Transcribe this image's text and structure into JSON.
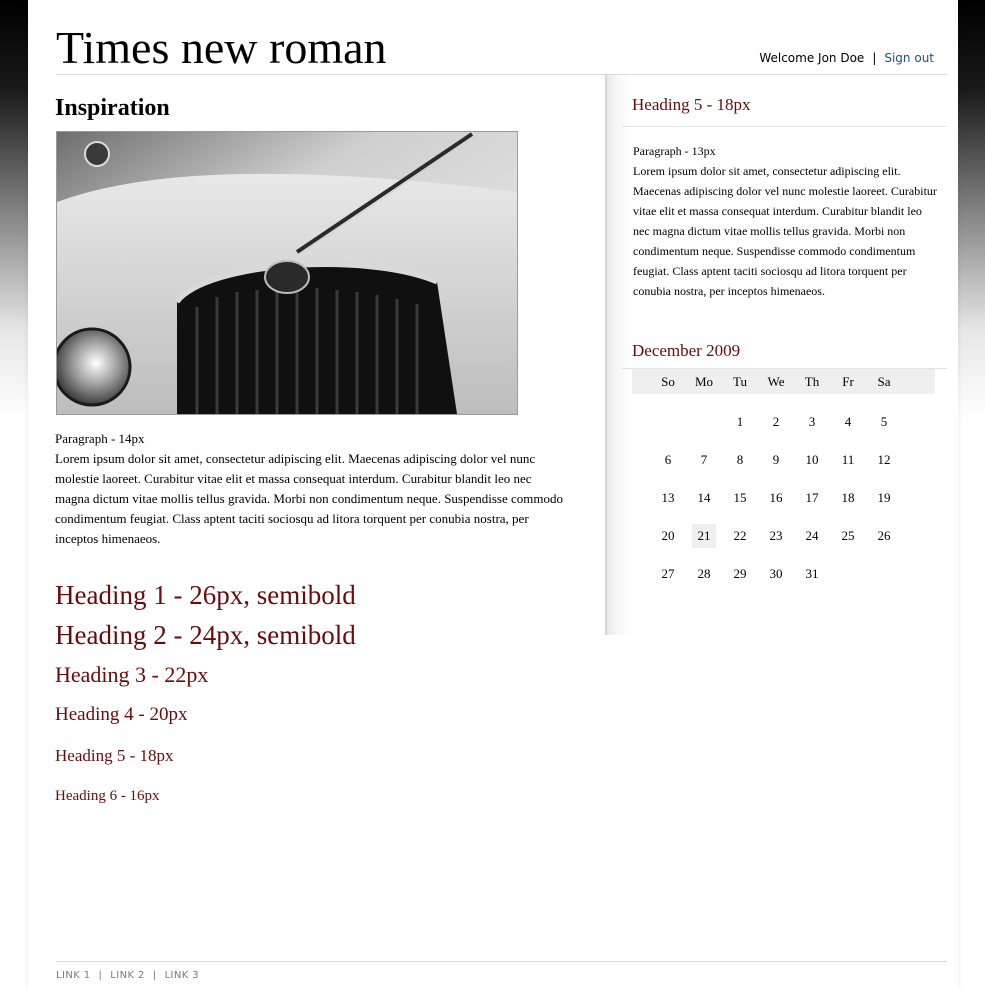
{
  "header": {
    "title": "Times new roman",
    "welcome": "Welcome Jon Doe",
    "separator": "|",
    "sign_out": "Sign out"
  },
  "main": {
    "section_title": "Inspiration",
    "image_icon": "car-photo",
    "paragraph_label": "Paragraph - 14px",
    "paragraph_text": "Lorem ipsum dolor sit amet, consectetur adipiscing elit. Maecenas adipiscing dolor vel nunc molestie laoreet. Curabitur vitae elit et massa consequat interdum. Curabitur blandit leo nec magna dictum vitae mollis tellus gravida. Morbi non condimentum neque. Suspendisse commodo condimentum feugiat. Class aptent taciti sociosqu ad litora torquent per conubia nostra, per inceptos himenaeos.",
    "headings": {
      "h1": "Heading 1 - 26px, semibold",
      "h2": "Heading 2 - 24px, semibold",
      "h3": "Heading 3 - 22px",
      "h4": "Heading 4 - 20px",
      "h5": "Heading 5 - 18px",
      "h6": "Heading 6 - 16px"
    }
  },
  "sidebar": {
    "heading": "Heading 5 - 18px",
    "paragraph_label": "Paragraph - 13px",
    "paragraph_text": "Lorem ipsum dolor sit amet, consectetur adipiscing elit. Maecenas adipiscing dolor vel nunc molestie laoreet. Curabitur vitae elit et massa consequat interdum. Curabitur blandit leo nec magna dictum vitae mollis tellus gravida. Morbi non condimentum neque. Suspendisse commodo condimentum feugiat. Class aptent taciti sociosqu ad litora torquent per conubia nostra, per inceptos himenaeos.",
    "calendar": {
      "title": "December 2009",
      "weekdays": [
        "So",
        "Mo",
        "Tu",
        "We",
        "Th",
        "Fr",
        "Sa"
      ],
      "weeks": [
        [
          "",
          "",
          "1",
          "2",
          "3",
          "4",
          "5"
        ],
        [
          "6",
          "7",
          "8",
          "9",
          "10",
          "11",
          "12"
        ],
        [
          "13",
          "14",
          "15",
          "16",
          "17",
          "18",
          "19"
        ],
        [
          "20",
          "21",
          "22",
          "23",
          "24",
          "25",
          "26"
        ],
        [
          "27",
          "28",
          "29",
          "30",
          "31",
          "",
          ""
        ]
      ],
      "today": "21"
    }
  },
  "footer": {
    "links": [
      "LINK 1",
      "LINK 2",
      "LINK 3"
    ],
    "separator": "|"
  },
  "colors": {
    "heading": "#6b0a0a",
    "link": "#1a4f8b",
    "footer_text": "#7a7a7a"
  }
}
